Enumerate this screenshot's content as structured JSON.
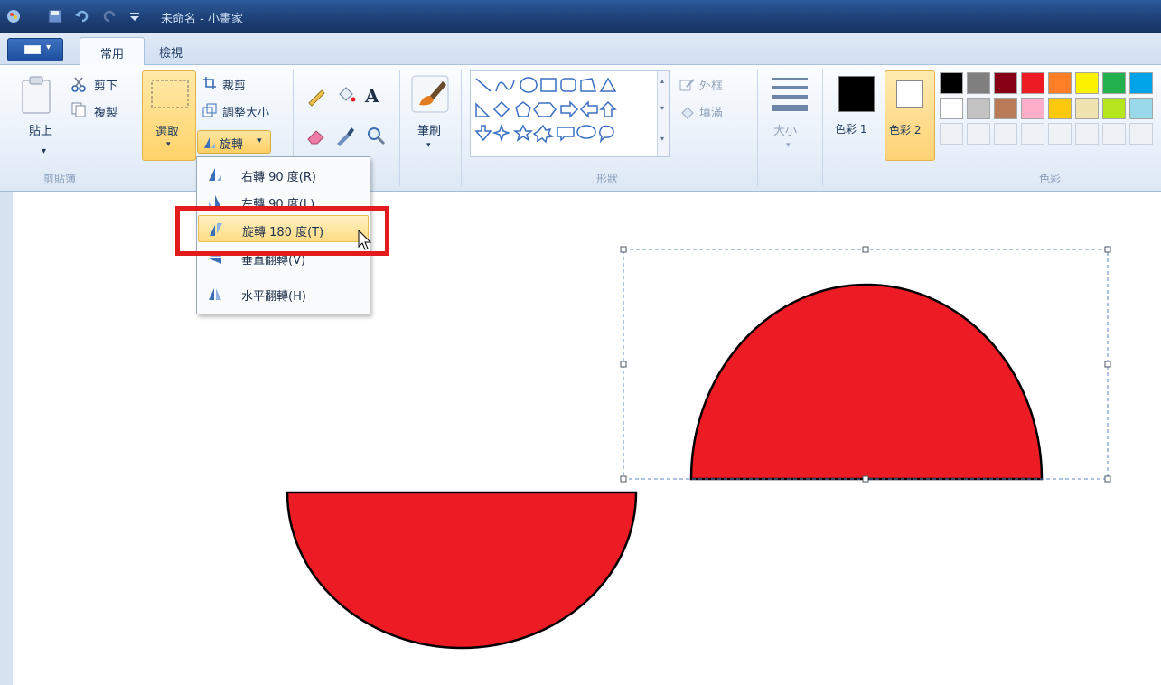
{
  "window": {
    "title": "未命名 - 小畫家"
  },
  "tabs": {
    "home": "常用",
    "view": "檢視"
  },
  "clipboard": {
    "paste": "貼上",
    "paste_arrow": "▾",
    "cut": "剪下",
    "copy": "複製",
    "group_label": "剪貼簿"
  },
  "image": {
    "select": "選取",
    "crop": "裁剪",
    "resize": "調整大小",
    "rotate": "旋轉"
  },
  "tools": {
    "text_tool_glyph": "A"
  },
  "brushes": {
    "label": "筆刷"
  },
  "shapes": {
    "outline": "外框",
    "fill": "填滿",
    "group_label": "形狀"
  },
  "size": {
    "label": "大小"
  },
  "colors": {
    "color1": "色彩 1",
    "color2": "色彩 2",
    "group_label": "色彩",
    "palette_row1": [
      "#000000",
      "#7f7f7f",
      "#880015",
      "#ed1c24",
      "#ff7f27",
      "#fff200",
      "#22b14c",
      "#00a2e8"
    ],
    "palette_row2": [
      "#ffffff",
      "#c3c3c3",
      "#b97a57",
      "#ffaec9",
      "#ffc90e",
      "#efe4b0",
      "#b5e61d",
      "#99d9ea"
    ]
  },
  "rotate_menu": {
    "items": [
      {
        "label": "右轉 90 度(R)"
      },
      {
        "label": "左轉 90 度(L)"
      },
      {
        "label": "旋轉 180 度(T)"
      },
      {
        "label": "垂直翻轉(V)"
      },
      {
        "label": "水平翻轉(H)"
      }
    ]
  },
  "canvas": {
    "shape_fill": "#ed1c24",
    "shape_stroke": "#000000"
  }
}
